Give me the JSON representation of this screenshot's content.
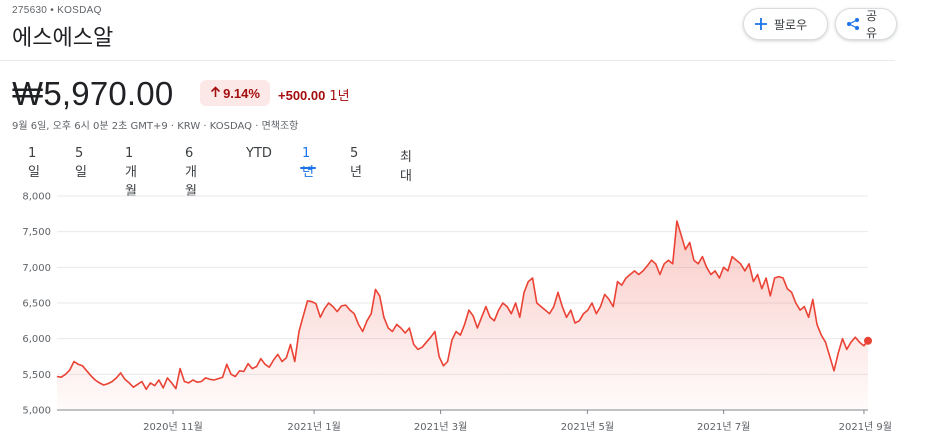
{
  "header": {
    "ticker": "275630 • KOSDAQ",
    "name": "에스에스알",
    "follow_label": "팔로우",
    "share_label": "공유"
  },
  "quote": {
    "price": "₩5,970.00",
    "change_pct": "9.14%",
    "change_abs": "+500.00",
    "change_period": "1년",
    "meta": "9월 6일, 오후 6시 0분 2초 GMT+9 · KRW · KOSDAQ · 면책조항"
  },
  "tabs": [
    "1일",
    "5일",
    "1개월",
    "6개월",
    "YTD",
    "1년",
    "5년",
    "최대"
  ],
  "active_tab": "1년",
  "colors": {
    "accent": "#1a73e8",
    "line": "#ea4335",
    "negative_text": "#a50e0e",
    "badge_bg": "#fce8e6"
  },
  "chart_data": {
    "type": "area",
    "ylim": [
      5000,
      8000
    ],
    "yticks": [
      5000,
      5500,
      6000,
      6500,
      7000,
      7500,
      8000
    ],
    "ytick_labels": [
      "5,000",
      "5,500",
      "6,000",
      "6,500",
      "7,000",
      "7,500",
      "8,000"
    ],
    "xticks": [
      {
        "label": "2020년 11월",
        "t": 0.143
      },
      {
        "label": "2021년 1월",
        "t": 0.317
      },
      {
        "label": "2021년 3월",
        "t": 0.473
      },
      {
        "label": "2021년 5월",
        "t": 0.654
      },
      {
        "label": "2021년 7월",
        "t": 0.822
      },
      {
        "label": "2021년 9월",
        "t": 0.995
      }
    ],
    "values": [
      5470,
      5460,
      5500,
      5560,
      5680,
      5640,
      5620,
      5550,
      5480,
      5420,
      5380,
      5350,
      5370,
      5400,
      5450,
      5520,
      5430,
      5380,
      5320,
      5360,
      5400,
      5290,
      5380,
      5340,
      5420,
      5310,
      5450,
      5380,
      5300,
      5580,
      5400,
      5380,
      5420,
      5390,
      5400,
      5450,
      5430,
      5420,
      5440,
      5460,
      5640,
      5500,
      5470,
      5550,
      5540,
      5650,
      5580,
      5610,
      5720,
      5640,
      5600,
      5700,
      5780,
      5680,
      5730,
      5920,
      5680,
      6100,
      6320,
      6530,
      6520,
      6490,
      6300,
      6420,
      6500,
      6450,
      6380,
      6460,
      6470,
      6400,
      6350,
      6200,
      6100,
      6250,
      6350,
      6690,
      6600,
      6300,
      6150,
      6100,
      6200,
      6150,
      6080,
      6150,
      5920,
      5850,
      5880,
      5950,
      6020,
      6100,
      5750,
      5620,
      5680,
      5980,
      6100,
      6050,
      6200,
      6400,
      6320,
      6150,
      6300,
      6450,
      6300,
      6250,
      6400,
      6500,
      6450,
      6350,
      6500,
      6300,
      6650,
      6800,
      6850,
      6500,
      6450,
      6400,
      6350,
      6450,
      6650,
      6450,
      6300,
      6400,
      6220,
      6250,
      6350,
      6400,
      6500,
      6350,
      6450,
      6620,
      6550,
      6450,
      6800,
      6750,
      6850,
      6900,
      6950,
      6900,
      6950,
      7020,
      7100,
      7050,
      6900,
      7050,
      7100,
      7050,
      7650,
      7450,
      7250,
      7350,
      7100,
      7050,
      7150,
      7000,
      6900,
      6950,
      6850,
      7000,
      6950,
      7150,
      7100,
      7050,
      6950,
      7050,
      6800,
      6900,
      6700,
      6850,
      6600,
      6850,
      6870,
      6850,
      6700,
      6650,
      6500,
      6400,
      6450,
      6300,
      6550,
      6200,
      6050,
      5950,
      5750,
      5550,
      5800,
      6000,
      5850,
      5950,
      6020,
      5950,
      5900,
      5970
    ]
  }
}
